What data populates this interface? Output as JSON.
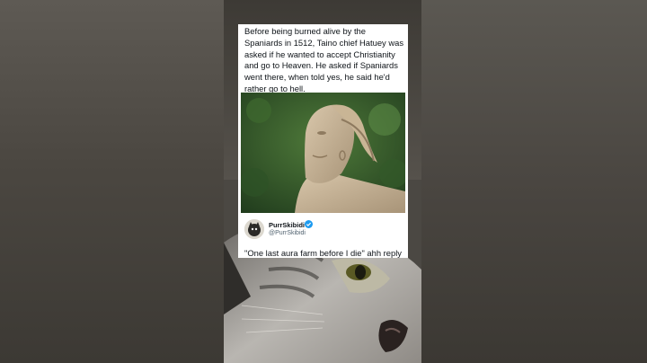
{
  "post": {
    "caption": "Before being burned alive by the Spaniards in 1512, Taino chief Hatuey was asked if he wanted to accept Christianity and go to Heaven. He asked if Spaniards went there, when told yes, he said he'd rather go to hell.",
    "author_name": "PurrSkibidi",
    "author_handle": "@PurrSkibidi",
    "reply_text": "\"One last aura farm before I die\" ahh reply"
  },
  "colors": {
    "card_bg": "#ffffff",
    "text": "#0f1419",
    "handle": "#536471",
    "verified_badge": "#1d9bf0"
  },
  "icons": {
    "verified": "verified-badge-icon",
    "avatar": "avatar"
  }
}
